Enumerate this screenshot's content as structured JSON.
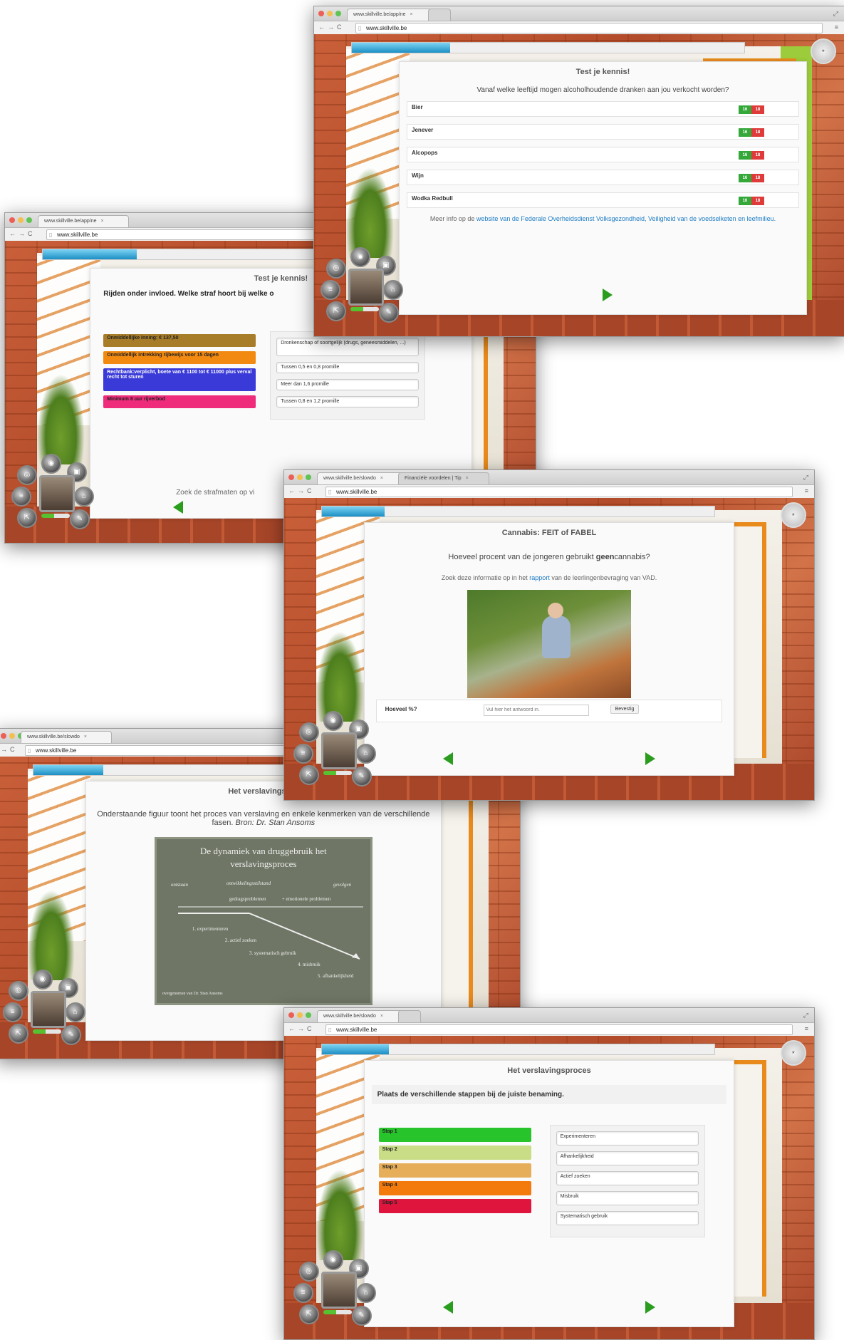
{
  "browser": {
    "tab_label": "www.skillville.be/app/ne",
    "tab_label_b": "www.skillville.be/slowdo",
    "tab_label_c": "Financiële voordelen | Tip",
    "url": "www.skillville.be",
    "close_glyph": "×"
  },
  "win1": {
    "title": "Test je kennis!",
    "question": "Vanaf welke leeftijd mogen alcoholhoudende dranken aan jou verkocht worden?",
    "rows": [
      {
        "label": "Bier"
      },
      {
        "label": "Jenever"
      },
      {
        "label": "Alcopops"
      },
      {
        "label": "Wijn"
      },
      {
        "label": "Wodka Redbull"
      }
    ],
    "opt16": "16",
    "opt18": "18",
    "info_prefix": "Meer info op de ",
    "info_link": "website van de Federale Overheidsdienst Volksgezondheid, Veiligheid van de voedselketen en leefmilieu.",
    "progress": 0.25
  },
  "win2": {
    "title": "Test je kennis!",
    "question": "Rijden onder invloed. Welke straf hoort bij welke o",
    "penalties": [
      {
        "label": "Onmiddellijke inning: € 137,50",
        "color": "#a87d2a"
      },
      {
        "label": "Onmiddellijk intrekking rijbewijs voor 15 dagen",
        "color": "#f28a12"
      },
      {
        "label": "Rechtbank:verplicht, boete van € 1100 tot € 11000 plus verval recht tot sturen",
        "color": "#3a3ad8"
      },
      {
        "label": "Minimum 8 uur rijverbod",
        "color": "#ee2c7b"
      }
    ],
    "slots": [
      "Dronkenschap of soortgelijk (drugs, geneesmiddelen, ...)",
      "Tussen 0,5 en 0,8 promille",
      "Meer dan 1,6 promille",
      "Tussen 0,8 en 1,2 promille"
    ],
    "footer": "Zoek de strafmaten op vi",
    "progress": 0.24
  },
  "win3": {
    "title": "Cannabis: FEIT of FABEL",
    "question_pre": "Hoeveel procent van de jongeren gebruikt ",
    "question_bold": "geen",
    "question_post": "cannabis?",
    "info_pre": "Zoek deze informatie op in het ",
    "info_link": "rapport",
    "info_post": " van de leerlingenbevraging van VAD.",
    "answer_label": "Hoeveel %?",
    "answer_placeholder": "Vul hier het antwoord in.",
    "confirm": "Bevestig",
    "progress": 0.16
  },
  "win4": {
    "title": "Het verslavingspro",
    "desc_main": "Onderstaande figuur toont het proces van verslaving en enkele kenmerken van de verschillende fasen. ",
    "desc_source": "Bron: Dr. Stan Ansoms",
    "board_title": "De dynamiek  van druggebruik het verslavingsproces",
    "board_labels": {
      "ontstaan": "ontstaan",
      "ontwikkeling": "ontwikkelingsstilstand",
      "gevolgen": "gevolgen",
      "gedrag": "gedragsproblemen",
      "emotioneel": "+ emotionele  problemen"
    },
    "board_steps": [
      "1. experimenteren",
      "2. actief zoeken",
      "3. systematisch gebruik",
      "4. misbruik",
      "5. afhankelijkheid"
    ],
    "board_credit": "overgenomen van Dr. Stan Ansoms",
    "progress": 0.18
  },
  "win5": {
    "title": "Het verslavingsproces",
    "instruction": "Plaats de verschillende stappen bij de juiste benaming.",
    "steps": [
      {
        "label": "Stap 1",
        "color": "#27c42c"
      },
      {
        "label": "Stap 2",
        "color": "#c9dc86"
      },
      {
        "label": "Stap 3",
        "color": "#e7ae5a"
      },
      {
        "label": "Stap 4",
        "color": "#f37a0d"
      },
      {
        "label": "Stap 5",
        "color": "#e0153e"
      }
    ],
    "names": [
      "Experimenteren",
      "Afhankelijkheid",
      "Actief zoeken",
      "Misbruik",
      "Systematisch gebruik"
    ],
    "progress": 0.17
  },
  "icons": [
    "back-arrow-icon",
    "forward-arrow-icon",
    "reload-icon",
    "menu-icon",
    "next-arrow-icon",
    "prev-arrow-icon",
    "skill-badge-icon"
  ]
}
